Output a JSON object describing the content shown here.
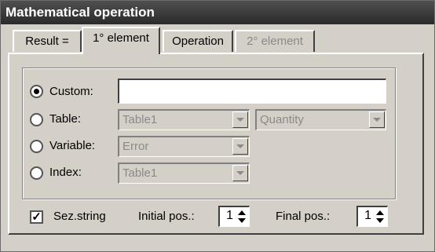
{
  "window": {
    "title": "Mathematical operation"
  },
  "tabs": [
    {
      "label": "Result =",
      "active": false,
      "disabled": false
    },
    {
      "label": "1° element",
      "active": true,
      "disabled": false
    },
    {
      "label": "Operation",
      "active": false,
      "disabled": false
    },
    {
      "label": "2° element",
      "active": false,
      "disabled": true
    }
  ],
  "source": {
    "selected": "custom",
    "custom_label": "Custom:",
    "custom_value": "",
    "table_label": "Table:",
    "table_value": "Table1",
    "table_field_value": "Quantity",
    "variable_label": "Variable:",
    "variable_value": "Error",
    "index_label": "Index:",
    "index_value": "Table1"
  },
  "substring": {
    "label": "Sez.string",
    "checked": true,
    "initial_label": "Initial pos.:",
    "initial_value": "1",
    "final_label": "Final pos.:",
    "final_value": "1"
  },
  "colors": {
    "title_bg": "#3c3c3c",
    "face": "#d4d0c8",
    "disabled_text": "#8a8a8a"
  }
}
